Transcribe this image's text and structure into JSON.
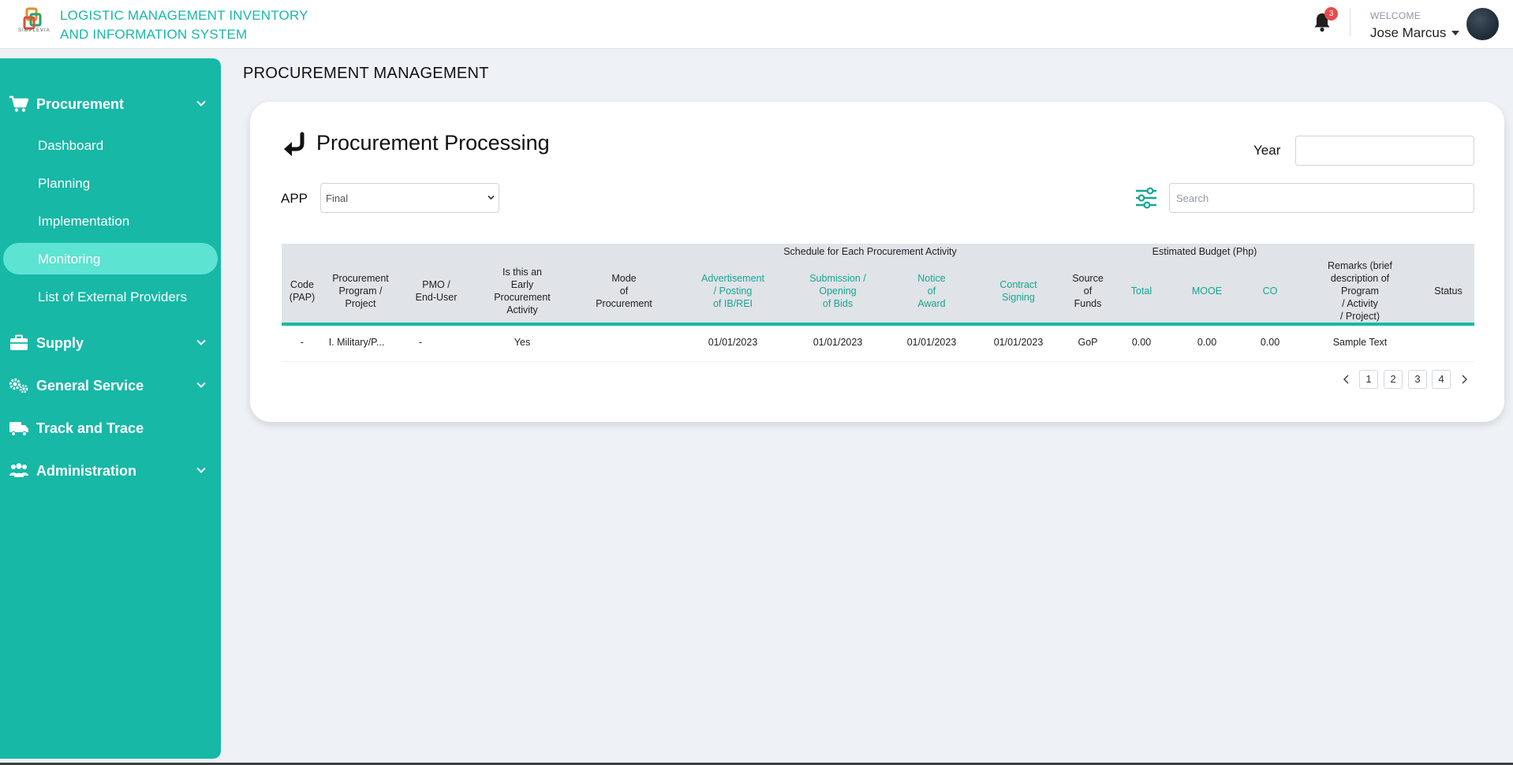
{
  "header": {
    "logo_subtext": "SIMPLEVIA",
    "app_title_line1": "LOGISTIC MANAGEMENT INVENTORY",
    "app_title_line2": "AND INFORMATION SYSTEM",
    "notification_count": "3",
    "welcome_label": "WELCOME",
    "user_name": "Jose Marcus",
    "icons": [
      "logo-icon",
      "bell-icon",
      "caret-down-icon",
      "avatar"
    ]
  },
  "sidebar": {
    "groups": [
      {
        "label": "Procurement",
        "icon": "cart-icon",
        "expanded": true
      },
      {
        "label": "Supply",
        "icon": "briefcase-icon"
      },
      {
        "label": "General Service",
        "icon": "gears-icon"
      },
      {
        "label": "Track and Trace",
        "icon": "truck-icon"
      },
      {
        "label": "Administration",
        "icon": "users-icon"
      }
    ],
    "procurement_items": [
      {
        "label": "Dashboard"
      },
      {
        "label": "Planning"
      },
      {
        "label": "Implementation"
      },
      {
        "label": "Monitoring",
        "active": true
      },
      {
        "label": "List of External Providers"
      }
    ]
  },
  "main": {
    "page_title": "PROCUREMENT MANAGEMENT",
    "card_title": "Procurement Processing",
    "year_label": "Year",
    "year_value": "",
    "app_label": "APP",
    "app_selected": "Final",
    "search_placeholder": "Search"
  },
  "table": {
    "group_headers": {
      "schedule": "Schedule for Each Procurement Activity",
      "budget": "Estimated Budget (Php)"
    },
    "columns": {
      "code": [
        "Code",
        "(PAP)"
      ],
      "program": [
        "Procurement",
        "Program /",
        "Project"
      ],
      "pmo": [
        "PMO /",
        "End-User"
      ],
      "early": [
        "Is this an",
        "Early",
        "Procurement",
        "Activity"
      ],
      "mode": [
        "Mode",
        "of",
        "Procurement"
      ],
      "advertisement": [
        "Advertisement",
        "/ Posting",
        "of IB/REI"
      ],
      "submission": [
        "Submission /",
        "Opening",
        "of Bids"
      ],
      "notice": [
        "Notice",
        "of",
        "Award"
      ],
      "contract": [
        "Contract",
        "Signing"
      ],
      "source": [
        "Source",
        "of",
        "Funds"
      ],
      "total": [
        "Total"
      ],
      "mooe": [
        "MOOE"
      ],
      "co": [
        "CO"
      ],
      "remarks": [
        "Remarks (brief",
        "description of",
        "Program",
        "/ Activity",
        "/ Project)"
      ],
      "status": [
        "Status"
      ]
    },
    "rows": [
      {
        "code": "-",
        "program": "I. Military/P...",
        "pmo": "-",
        "early": "Yes",
        "mode": "",
        "advertisement": "01/01/2023",
        "submission": "01/01/2023",
        "notice": "01/01/2023",
        "contract": "01/01/2023",
        "source": "GoP",
        "total": "0.00",
        "mooe": "0.00",
        "co": "0.00",
        "remarks": "Sample Text",
        "status": ""
      }
    ]
  },
  "pagination": {
    "pages": [
      "1",
      "2",
      "3",
      "4"
    ]
  },
  "colors": {
    "accent": "#17b8a6",
    "active_item": "#5de3d2",
    "teal_text": "#17a596",
    "badge": "#e84b4b"
  }
}
